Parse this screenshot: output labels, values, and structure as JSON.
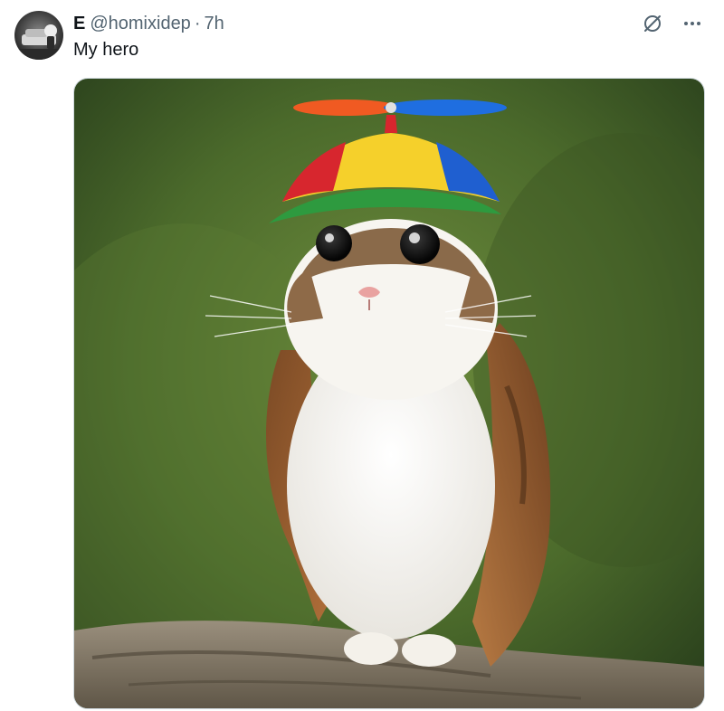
{
  "post": {
    "display_name": "E",
    "handle": "@homixidep",
    "separator": "·",
    "time": "7h",
    "text": "My hero"
  },
  "icons": {
    "grok": "grok-slash-circle-icon",
    "more": "more-horizontal-icon"
  },
  "media": {
    "type": "image"
  },
  "colors": {
    "text_primary": "#0f1419",
    "text_secondary": "#536471",
    "cap_red": "#d7262e",
    "cap_yellow": "#f5d02b",
    "cap_blue": "#1f5fd0",
    "cap_green": "#2e9a3f",
    "propeller_orange": "#f05a22",
    "propeller_blue": "#1f6ee0"
  }
}
